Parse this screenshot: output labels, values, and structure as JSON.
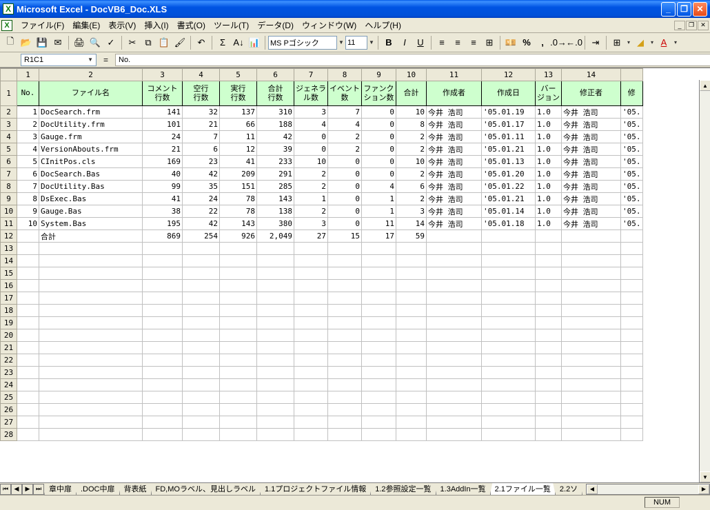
{
  "title": "Microsoft Excel - DocVB6_Doc.XLS",
  "menus": [
    "ファイル(F)",
    "編集(E)",
    "表示(V)",
    "挿入(I)",
    "書式(O)",
    "ツール(T)",
    "データ(D)",
    "ウィンドウ(W)",
    "ヘルプ(H)"
  ],
  "name_box": "R1C1",
  "formula": "No.",
  "font_name": "MS Pゴシック",
  "font_size": "11",
  "col_numbers": [
    "1",
    "2",
    "3",
    "4",
    "5",
    "6",
    "7",
    "8",
    "9",
    "10",
    "11",
    "12",
    "13",
    "14",
    ""
  ],
  "headers": [
    "No.",
    "ファイル名",
    "コメント\n行数",
    "空行\n行数",
    "実行\n行数",
    "合計\n行数",
    "ジェネラ\nル数",
    "イベント\n数",
    "ファンク\nション数",
    "合計",
    "作成者",
    "作成日",
    "バー\nジョン",
    "修正者",
    "修"
  ],
  "rows": [
    {
      "n": "1",
      "file": "DocSearch.frm",
      "c": "141",
      "b": "32",
      "e": "137",
      "t": "310",
      "g": "3",
      "ev": "7",
      "fn": "0",
      "tot": "10",
      "au": "今井 浩司",
      "cd": "'05.01.19",
      "v": "1.0",
      "mu": "今井 浩司",
      "md": "'05."
    },
    {
      "n": "2",
      "file": "DocUtility.frm",
      "c": "101",
      "b": "21",
      "e": "66",
      "t": "188",
      "g": "4",
      "ev": "4",
      "fn": "0",
      "tot": "8",
      "au": "今井 浩司",
      "cd": "'05.01.17",
      "v": "1.0",
      "mu": "今井 浩司",
      "md": "'05."
    },
    {
      "n": "3",
      "file": "Gauge.frm",
      "c": "24",
      "b": "7",
      "e": "11",
      "t": "42",
      "g": "0",
      "ev": "2",
      "fn": "0",
      "tot": "2",
      "au": "今井 浩司",
      "cd": "'05.01.11",
      "v": "1.0",
      "mu": "今井 浩司",
      "md": "'05."
    },
    {
      "n": "4",
      "file": "VersionAbouts.frm",
      "c": "21",
      "b": "6",
      "e": "12",
      "t": "39",
      "g": "0",
      "ev": "2",
      "fn": "0",
      "tot": "2",
      "au": "今井 浩司",
      "cd": "'05.01.21",
      "v": "1.0",
      "mu": "今井 浩司",
      "md": "'05."
    },
    {
      "n": "5",
      "file": "CInitPos.cls",
      "c": "169",
      "b": "23",
      "e": "41",
      "t": "233",
      "g": "10",
      "ev": "0",
      "fn": "0",
      "tot": "10",
      "au": "今井 浩司",
      "cd": "'05.01.13",
      "v": "1.0",
      "mu": "今井 浩司",
      "md": "'05."
    },
    {
      "n": "6",
      "file": "DocSearch.Bas",
      "c": "40",
      "b": "42",
      "e": "209",
      "t": "291",
      "g": "2",
      "ev": "0",
      "fn": "0",
      "tot": "2",
      "au": "今井 浩司",
      "cd": "'05.01.20",
      "v": "1.0",
      "mu": "今井 浩司",
      "md": "'05."
    },
    {
      "n": "7",
      "file": "DocUtility.Bas",
      "c": "99",
      "b": "35",
      "e": "151",
      "t": "285",
      "g": "2",
      "ev": "0",
      "fn": "4",
      "tot": "6",
      "au": "今井 浩司",
      "cd": "'05.01.22",
      "v": "1.0",
      "mu": "今井 浩司",
      "md": "'05."
    },
    {
      "n": "8",
      "file": "DsExec.Bas",
      "c": "41",
      "b": "24",
      "e": "78",
      "t": "143",
      "g": "1",
      "ev": "0",
      "fn": "1",
      "tot": "2",
      "au": "今井 浩司",
      "cd": "'05.01.21",
      "v": "1.0",
      "mu": "今井 浩司",
      "md": "'05."
    },
    {
      "n": "9",
      "file": "Gauge.Bas",
      "c": "38",
      "b": "22",
      "e": "78",
      "t": "138",
      "g": "2",
      "ev": "0",
      "fn": "1",
      "tot": "3",
      "au": "今井 浩司",
      "cd": "'05.01.14",
      "v": "1.0",
      "mu": "今井 浩司",
      "md": "'05."
    },
    {
      "n": "10",
      "file": "System.Bas",
      "c": "195",
      "b": "42",
      "e": "143",
      "t": "380",
      "g": "3",
      "ev": "0",
      "fn": "11",
      "tot": "14",
      "au": "今井 浩司",
      "cd": "'05.01.18",
      "v": "1.0",
      "mu": "今井 浩司",
      "md": "'05."
    }
  ],
  "total_row": {
    "label": "合計",
    "c": "869",
    "b": "254",
    "e": "926",
    "t": "2,049",
    "g": "27",
    "ev": "15",
    "fn": "17",
    "tot": "59"
  },
  "empty_rows": [
    "13",
    "14",
    "15",
    "16",
    "17",
    "18",
    "19",
    "20",
    "21",
    "22",
    "23",
    "24",
    "25",
    "26",
    "27",
    "28"
  ],
  "sheet_tabs": [
    "章中扉",
    ".DOC中扉",
    "背表紙",
    "FD,MOラベル、見出しラベル",
    "1.1プロジェクトファイル情報",
    "1.2参照設定一覧",
    "1.3AddIn一覧",
    "2.1ファイル一覧",
    "2.2ソ"
  ],
  "active_tab": 7,
  "status_num": "NUM"
}
